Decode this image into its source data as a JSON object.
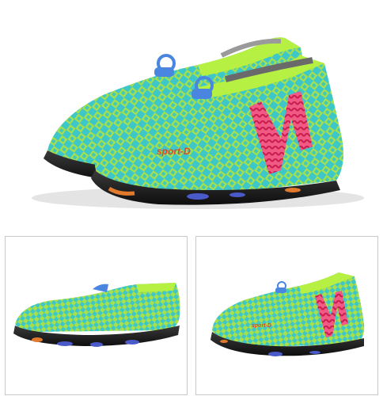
{
  "product": {
    "brand_text": "sport-D"
  },
  "colors": {
    "upper_teal": "#3ec7c9",
    "diamond_green": "#a8e04a",
    "chevron_red": "#d8285a",
    "collar_lime": "#b5f043",
    "sole_black": "#1b1b1b",
    "pull_tab_blue": "#4a86e0",
    "brand_orange": "#d84a2a"
  }
}
